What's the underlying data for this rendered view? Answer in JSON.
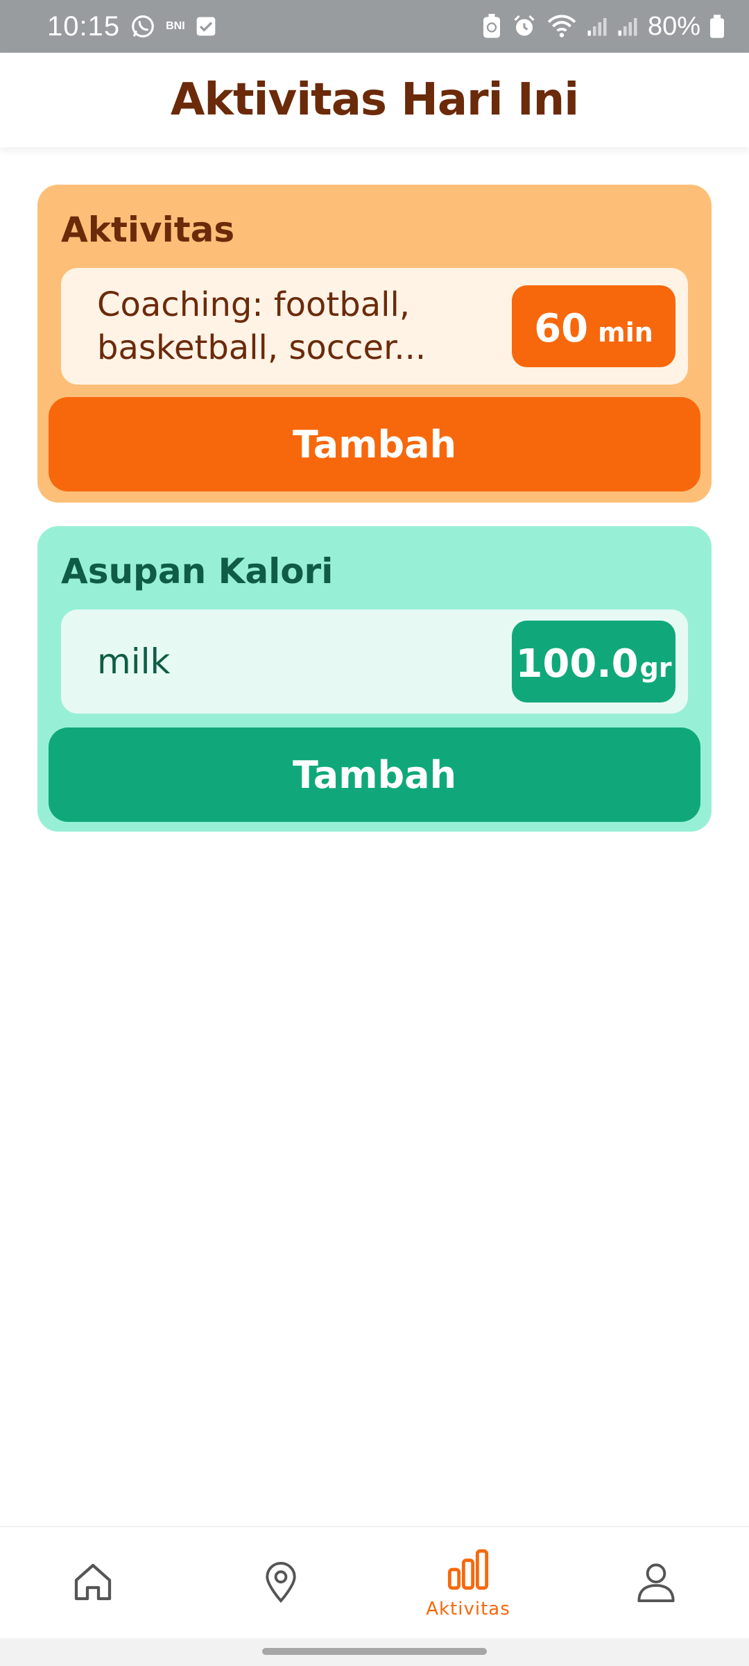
{
  "status_bar": {
    "time": "10:15",
    "notification_icons": [
      "whatsapp-icon",
      "bni-icon",
      "checkbox-icon"
    ],
    "bni_label": "BNI",
    "system_icons": [
      "battery-saver-icon",
      "alarm-icon",
      "wifi-icon",
      "signal-icon",
      "signal-icon"
    ],
    "battery_percent": "80%"
  },
  "header": {
    "title": "Aktivitas Hari Ini"
  },
  "activity_card": {
    "title": "Aktivitas",
    "entry": {
      "name": "Coaching: football, basketball, soccer...",
      "value": "60",
      "unit": "min"
    },
    "add_label": "Tambah",
    "colors": {
      "background": "#fdbf78",
      "accent": "#f7680c",
      "text": "#6b2a0a"
    }
  },
  "calorie_card": {
    "title": "Asupan Kalori",
    "entry": {
      "name": "milk",
      "value": "100.0",
      "unit": "gr"
    },
    "add_label": "Tambah",
    "colors": {
      "background": "#97f0d5",
      "accent": "#10a87a",
      "text": "#0f5c44"
    }
  },
  "bottom_nav": {
    "items": [
      {
        "icon": "home-icon",
        "label": "",
        "active": false
      },
      {
        "icon": "map-pin-icon",
        "label": "",
        "active": false
      },
      {
        "icon": "bar-chart-icon",
        "label": "Aktivitas",
        "active": true
      },
      {
        "icon": "user-icon",
        "label": "",
        "active": false
      }
    ],
    "active_color": "#f7680c",
    "inactive_color": "#555555"
  }
}
